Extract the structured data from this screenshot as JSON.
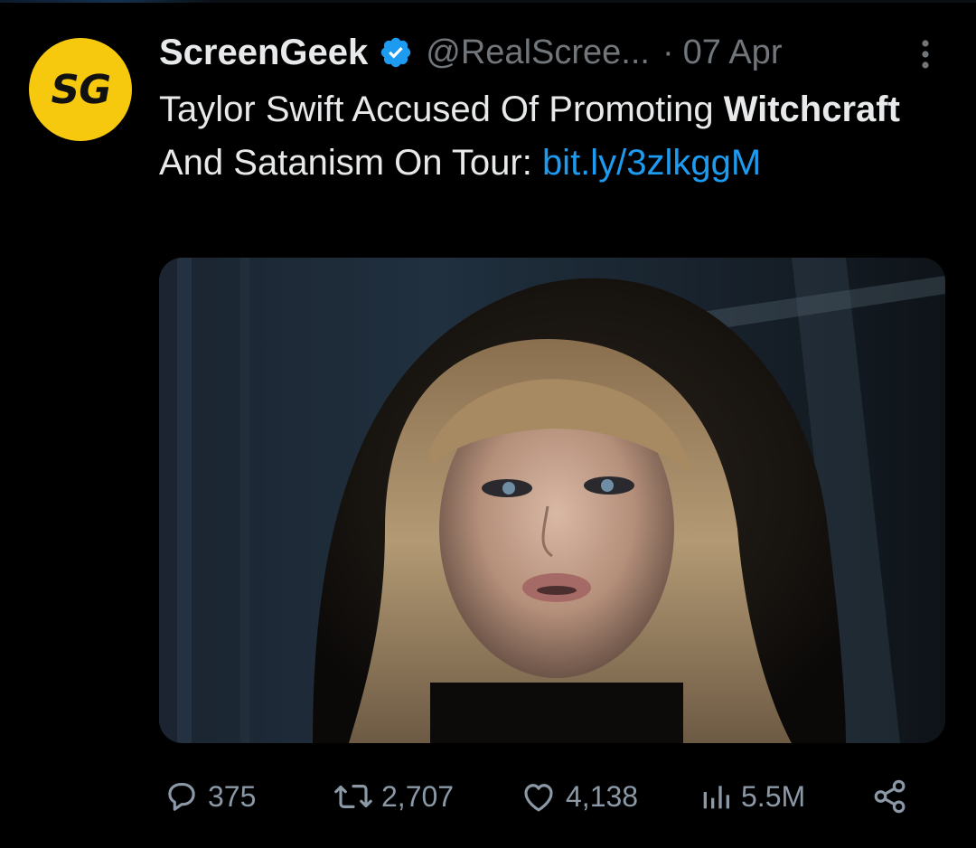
{
  "colors": {
    "background": "#000000",
    "primary_text": "#e7e9ea",
    "secondary_text": "#71767b",
    "link": "#1d9bf0",
    "verified_badge": "#1d9bf0",
    "avatar_background": "#f6c90e"
  },
  "tweet": {
    "avatar": {
      "text": "SG",
      "icon": "screengeek-logo"
    },
    "display_name": "ScreenGeek",
    "verified_icon": "verified-badge-icon",
    "handle": "@RealScree...",
    "separator": "·",
    "date": "07 Apr",
    "more_icon": "more-vertical-icon",
    "text": {
      "part1": "Taylor Swift Accused Of Promoting ",
      "bold": "Witchcraft",
      "part2": " And Satanism On Tour: ",
      "link": "bit.ly/3zlkggM"
    },
    "media": {
      "icon": "tweet-photo"
    },
    "actions": {
      "replies": {
        "icon": "reply-icon",
        "count": "375"
      },
      "retweets": {
        "icon": "retweet-icon",
        "count": "2,707"
      },
      "likes": {
        "icon": "heart-icon",
        "count": "4,138"
      },
      "views": {
        "icon": "views-icon",
        "count": "5.5M"
      },
      "share": {
        "icon": "share-icon"
      }
    }
  }
}
